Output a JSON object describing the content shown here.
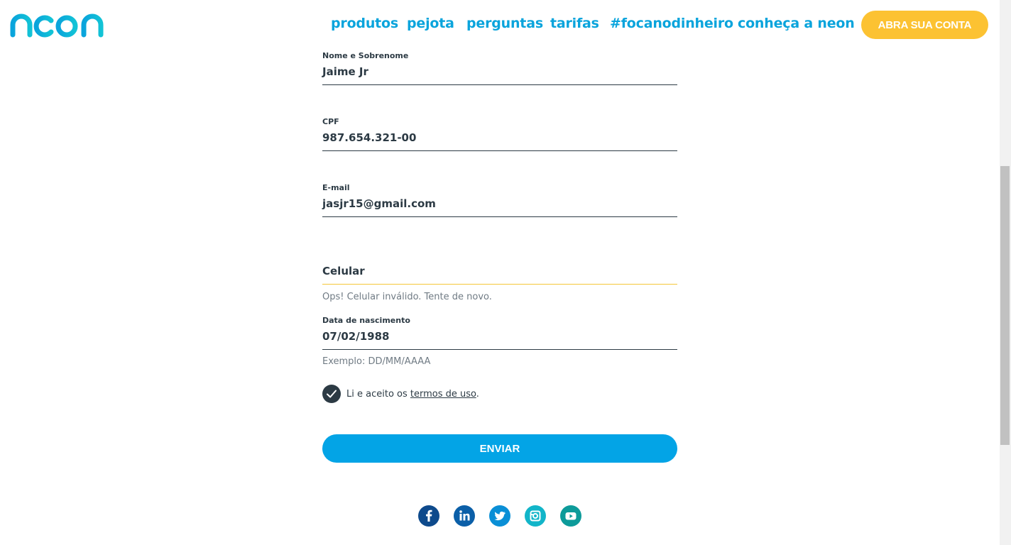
{
  "brand": {
    "logo_text": "neon",
    "color": "#0aa4dc"
  },
  "nav": {
    "items": [
      {
        "label": "produtos"
      },
      {
        "label": "pejota"
      },
      {
        "label": "perguntas"
      },
      {
        "label": "tarifas"
      },
      {
        "label": "#focanodinheiro"
      },
      {
        "label": "conheça a neon"
      }
    ],
    "cta_label": "ABRA SUA CONTA",
    "cta_color": "#fcc232"
  },
  "form": {
    "name": {
      "label": "Nome e Sobrenome",
      "value": "Jaime Jr"
    },
    "cpf": {
      "label": "CPF",
      "value": "987.654.321-00"
    },
    "email": {
      "label": "E-mail",
      "value": "jasjr15@gmail.com"
    },
    "phone": {
      "placeholder": "Celular",
      "error": "Ops! Celular inválido. Tente de novo."
    },
    "birth": {
      "label": "Data de nascimento",
      "value": "07/02/1988",
      "hint": "Exemplo: DD/MM/AAAA"
    },
    "terms": {
      "checked": true,
      "prefix": "Li e aceito os ",
      "link": "termos de uso",
      "suffix": "."
    },
    "submit_label": "ENVIAR",
    "submit_color": "#03a4e6"
  },
  "social": [
    {
      "icon": "facebook-icon",
      "color": "#0e4a8c"
    },
    {
      "icon": "linkedin-icon",
      "color": "#0b5fa8"
    },
    {
      "icon": "twitter-icon",
      "color": "#0a8fd6"
    },
    {
      "icon": "instagram-icon",
      "color": "#12b5c9"
    },
    {
      "icon": "youtube-icon",
      "color": "#0d9b9a"
    }
  ]
}
